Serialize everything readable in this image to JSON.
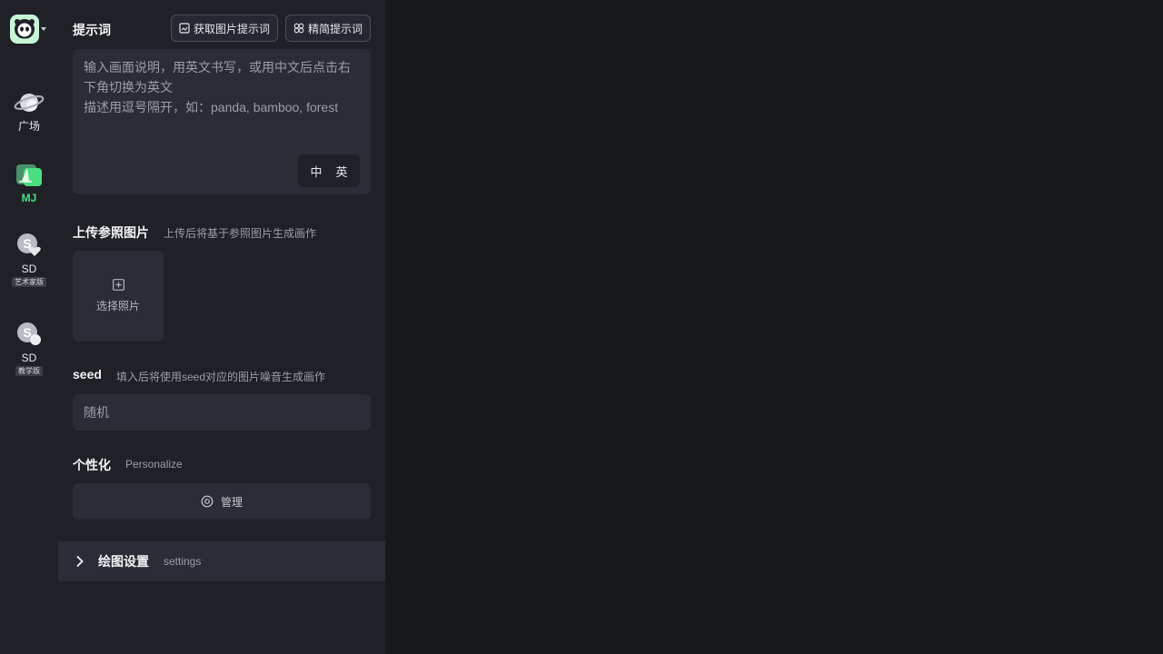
{
  "nav": {
    "items": [
      {
        "label": "广场",
        "sub": ""
      },
      {
        "label": "MJ",
        "sub": ""
      },
      {
        "label": "SD",
        "sub": "艺术家版"
      },
      {
        "label": "SD",
        "sub": "教学版"
      }
    ]
  },
  "prompt": {
    "title": "提示词",
    "get_image_prompt_label": "获取图片提示词",
    "simplify_prompt_label": "精简提示词",
    "placeholder_line1": "输入画面说明，用英文书写，或用中文后点击右下角切换为英文",
    "placeholder_line2": "描述用逗号隔开，如：panda, bamboo, forest",
    "lang_zh": "中",
    "lang_en": "英"
  },
  "upload": {
    "title": "上传参照图片",
    "hint": "上传后将基于参照图片生成画作",
    "choose_label": "选择照片"
  },
  "seed": {
    "title": "seed",
    "hint": "填入后将使用seed对应的图片噪音生成画作",
    "placeholder": "随机"
  },
  "personalize": {
    "title": "个性化",
    "hint": "Personalize",
    "manage_label": "管理"
  },
  "settings": {
    "title": "绘图设置",
    "hint": "settings"
  },
  "colors": {
    "background": "#18191d",
    "panel": "#1f2127",
    "field": "#2a2d35",
    "accent": "#4ade80"
  }
}
